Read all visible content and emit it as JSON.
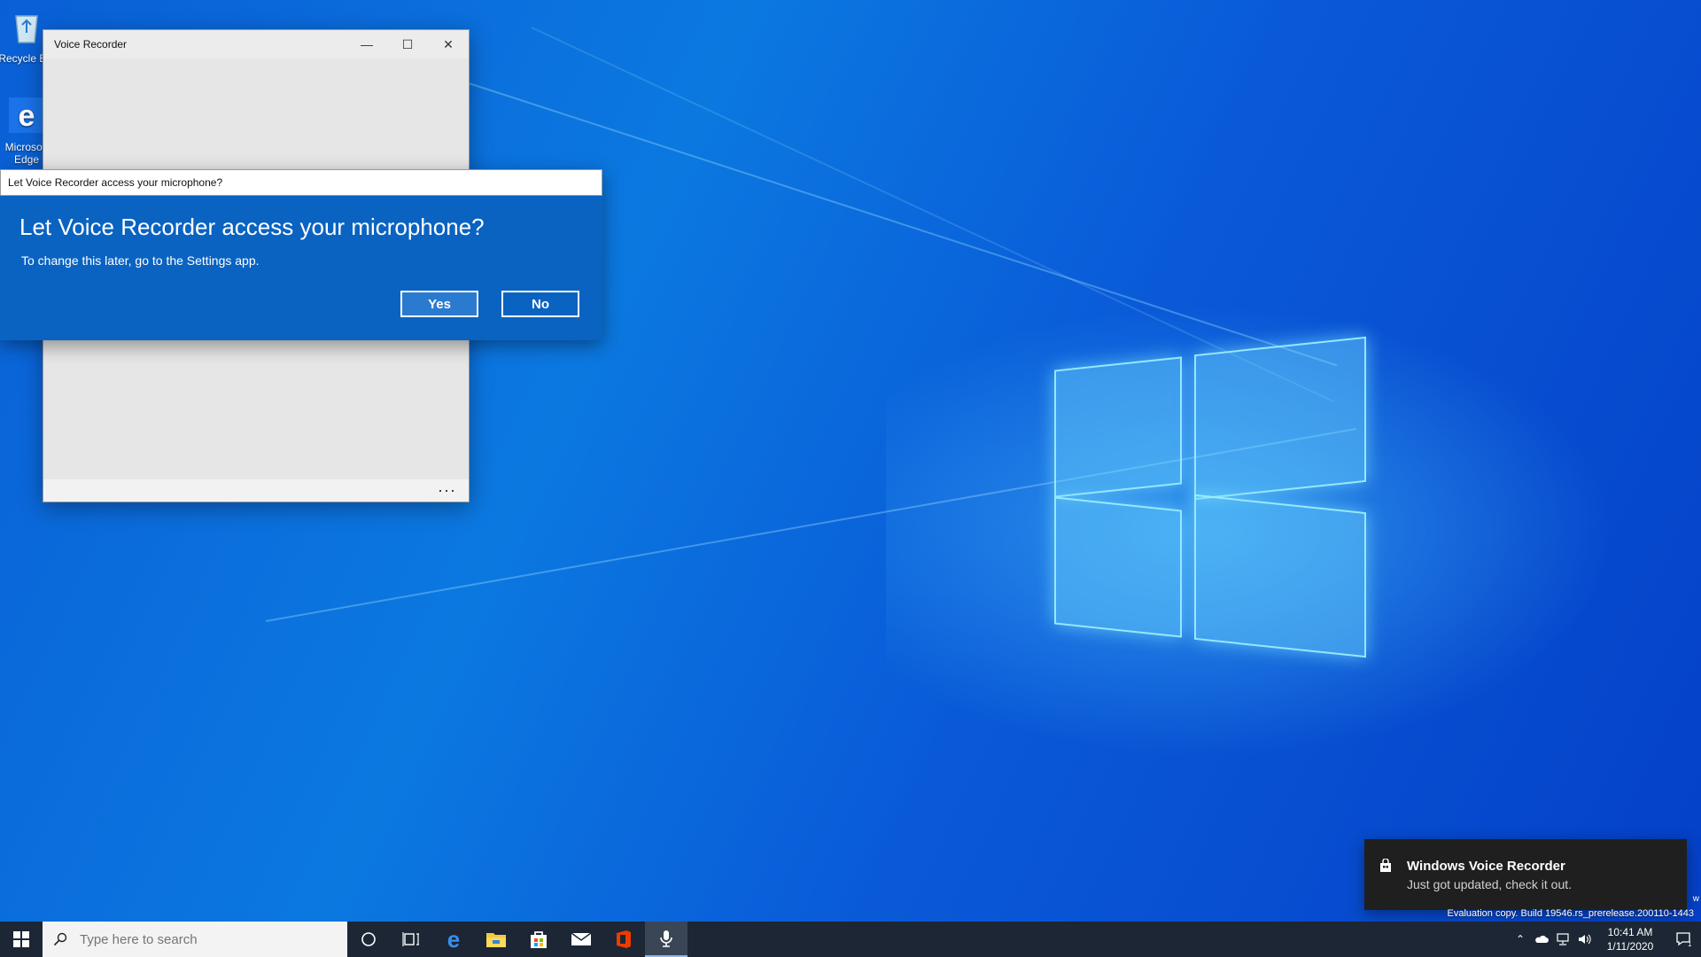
{
  "desktop": {
    "icons": [
      {
        "label": "Recycle Bin",
        "icon": "recycle-bin-icon"
      },
      {
        "label": "Microsoft Edge",
        "icon": "edge-icon"
      }
    ]
  },
  "vr_window": {
    "title": "Voice Recorder",
    "minimize_glyph": "—",
    "maximize_glyph": "☐",
    "close_glyph": "✕",
    "more_glyph": "···"
  },
  "dialog": {
    "title": "Let Voice Recorder access your microphone?",
    "heading": "Let Voice Recorder access your microphone?",
    "subtext": "To change this later, go to the Settings app.",
    "yes_label": "Yes",
    "no_label": "No"
  },
  "toast": {
    "title": "Windows Voice Recorder",
    "body": "Just got updated, check it out.",
    "icon": "store-bag-icon"
  },
  "watermark": {
    "eval_text": "Evaluation copy. Build 19546.rs_prerelease.200110-1443",
    "edge_text": "w"
  },
  "taskbar": {
    "search_placeholder": "Type here to search",
    "apps": [
      "cortana-icon",
      "task-view-icon",
      "edge-icon",
      "file-explorer-icon",
      "store-icon",
      "mail-icon",
      "office-icon",
      "voice-recorder-icon"
    ],
    "clock_time": "10:41 AM",
    "clock_date": "1/11/2020",
    "notification_count": "1"
  },
  "colors": {
    "dialog_blue": "#0a63c1",
    "taskbar": "#1c2634",
    "toast": "#1f1f1f"
  }
}
